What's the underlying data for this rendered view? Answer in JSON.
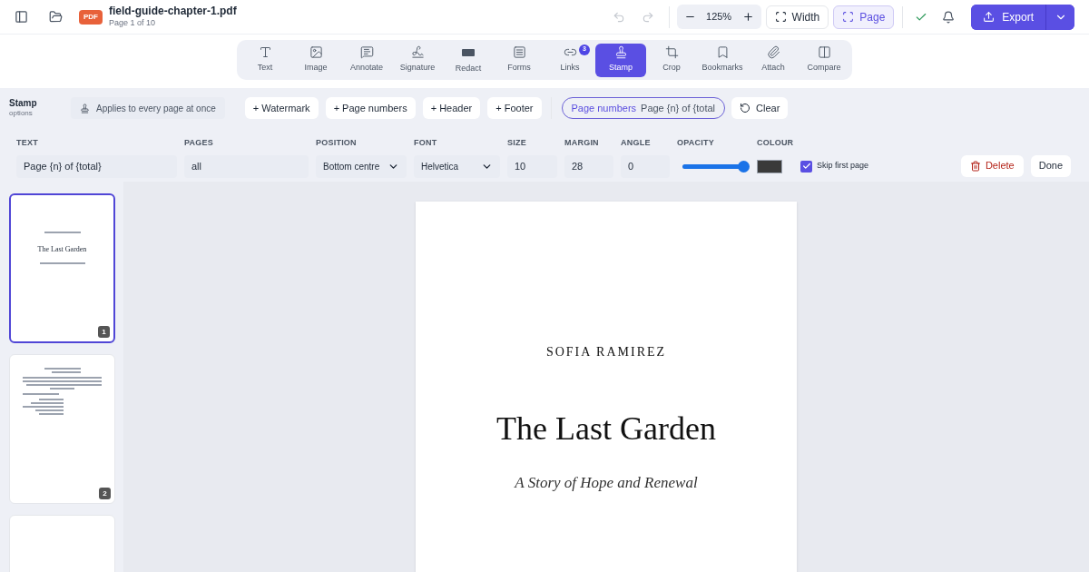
{
  "file": {
    "badge": "PDF",
    "name": "field-guide-chapter-1.pdf",
    "pages": "Page 1 of 10"
  },
  "zoom": {
    "value": "125%"
  },
  "fit": [
    {
      "label": "Width",
      "selected": false
    },
    {
      "label": "Page",
      "selected": true
    }
  ],
  "export": {
    "label": "Export"
  },
  "tools": [
    {
      "kind": "text",
      "label": "Text",
      "selected": false
    },
    {
      "kind": "image",
      "label": "Image",
      "selected": false
    },
    {
      "kind": "annotate",
      "label": "Annotate",
      "selected": false
    },
    {
      "kind": "signature",
      "label": "Signature",
      "selected": false
    },
    {
      "kind": "redact",
      "label": "Redact",
      "selected": false
    },
    {
      "kind": "forms",
      "label": "Forms",
      "selected": false
    },
    {
      "kind": "links",
      "label": "Links",
      "selected": false,
      "badge": "3"
    },
    {
      "kind": "stamp",
      "label": "Stamp",
      "selected": true
    },
    {
      "kind": "crop",
      "label": "Crop",
      "selected": false
    },
    {
      "kind": "bookmarks",
      "label": "Bookmarks",
      "selected": false
    },
    {
      "kind": "attach",
      "label": "Attach",
      "selected": false
    },
    {
      "kind": "compare",
      "label": "Compare",
      "selected": false
    }
  ],
  "options": {
    "title": "Stamp",
    "subtitle": "options",
    "hint": "Applies to every page at once",
    "presets": [
      "+ Watermark",
      "+ Page numbers",
      "+ Header",
      "+ Footer"
    ],
    "active_stamp": {
      "type": "Page numbers",
      "text": "Page {n} of {total"
    },
    "clear": "Clear",
    "fields": [
      {
        "kind": "input",
        "label": "TEXT",
        "value": "Page {n} of {total}"
      },
      {
        "kind": "input",
        "label": "PAGES",
        "value": "all"
      },
      {
        "kind": "select",
        "label": "POSITION",
        "value": "Bottom centre"
      },
      {
        "kind": "select",
        "label": "FONT",
        "value": "Helvetica"
      },
      {
        "kind": "input",
        "label": "SIZE",
        "value": "10"
      },
      {
        "kind": "input",
        "label": "MARGIN",
        "value": "28"
      },
      {
        "kind": "input",
        "label": "ANGLE",
        "value": "0"
      },
      {
        "kind": "slider",
        "label": "OPACITY",
        "level": 1
      },
      {
        "kind": "color",
        "label": "COLOUR",
        "color": "#3a3a3a"
      }
    ],
    "skip_first": {
      "label": "Skip first page",
      "checked": true
    },
    "delete": "Delete",
    "done": "Done"
  },
  "thumbnails": [
    {
      "number": "1",
      "selected": true,
      "title": "The Last Garden"
    },
    {
      "number": "2",
      "selected": false
    }
  ],
  "page": {
    "author": "SOFIA RAMIREZ",
    "title": "The Last Garden",
    "subtitle": "A Story of Hope and Renewal"
  }
}
